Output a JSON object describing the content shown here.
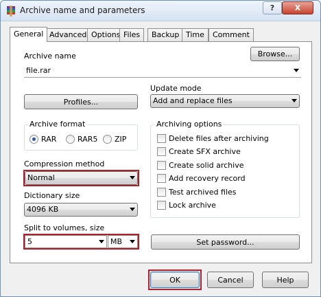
{
  "window": {
    "title": "Archive name and parameters",
    "help_label": "?",
    "close_label": "X"
  },
  "tabs": [
    {
      "label": "General",
      "active": true
    },
    {
      "label": "Advanced"
    },
    {
      "label": "Options"
    },
    {
      "label": "Files"
    },
    {
      "label": "Backup"
    },
    {
      "label": "Time"
    },
    {
      "label": "Comment"
    }
  ],
  "general": {
    "archive_name_label": "Archive name",
    "archive_name_value": "file.rar",
    "browse_label": "Browse...",
    "profiles_label": "Profiles...",
    "update_mode_label": "Update mode",
    "update_mode_value": "Add and replace files",
    "archive_format": {
      "title": "Archive format",
      "options": [
        "RAR",
        "RAR5",
        "ZIP"
      ],
      "selected": "RAR"
    },
    "compression_method_label": "Compression method",
    "compression_method_value": "Normal",
    "dictionary_size_label": "Dictionary size",
    "dictionary_size_value": "4096 KB",
    "split_label": "Split to volumes, size",
    "split_value": "5",
    "split_unit": "MB",
    "archiving_options": {
      "title": "Archiving options",
      "items": [
        "Delete files after archiving",
        "Create SFX archive",
        "Create solid archive",
        "Add recovery record",
        "Test archived files",
        "Lock archive"
      ]
    },
    "set_password_label": "Set password..."
  },
  "buttons": {
    "ok": "OK",
    "cancel": "Cancel",
    "help": "Help"
  },
  "colors": {
    "highlight_red": "#b0202a",
    "titlebar": "#d6e3f2",
    "radio_dot": "#2b5aa6"
  }
}
